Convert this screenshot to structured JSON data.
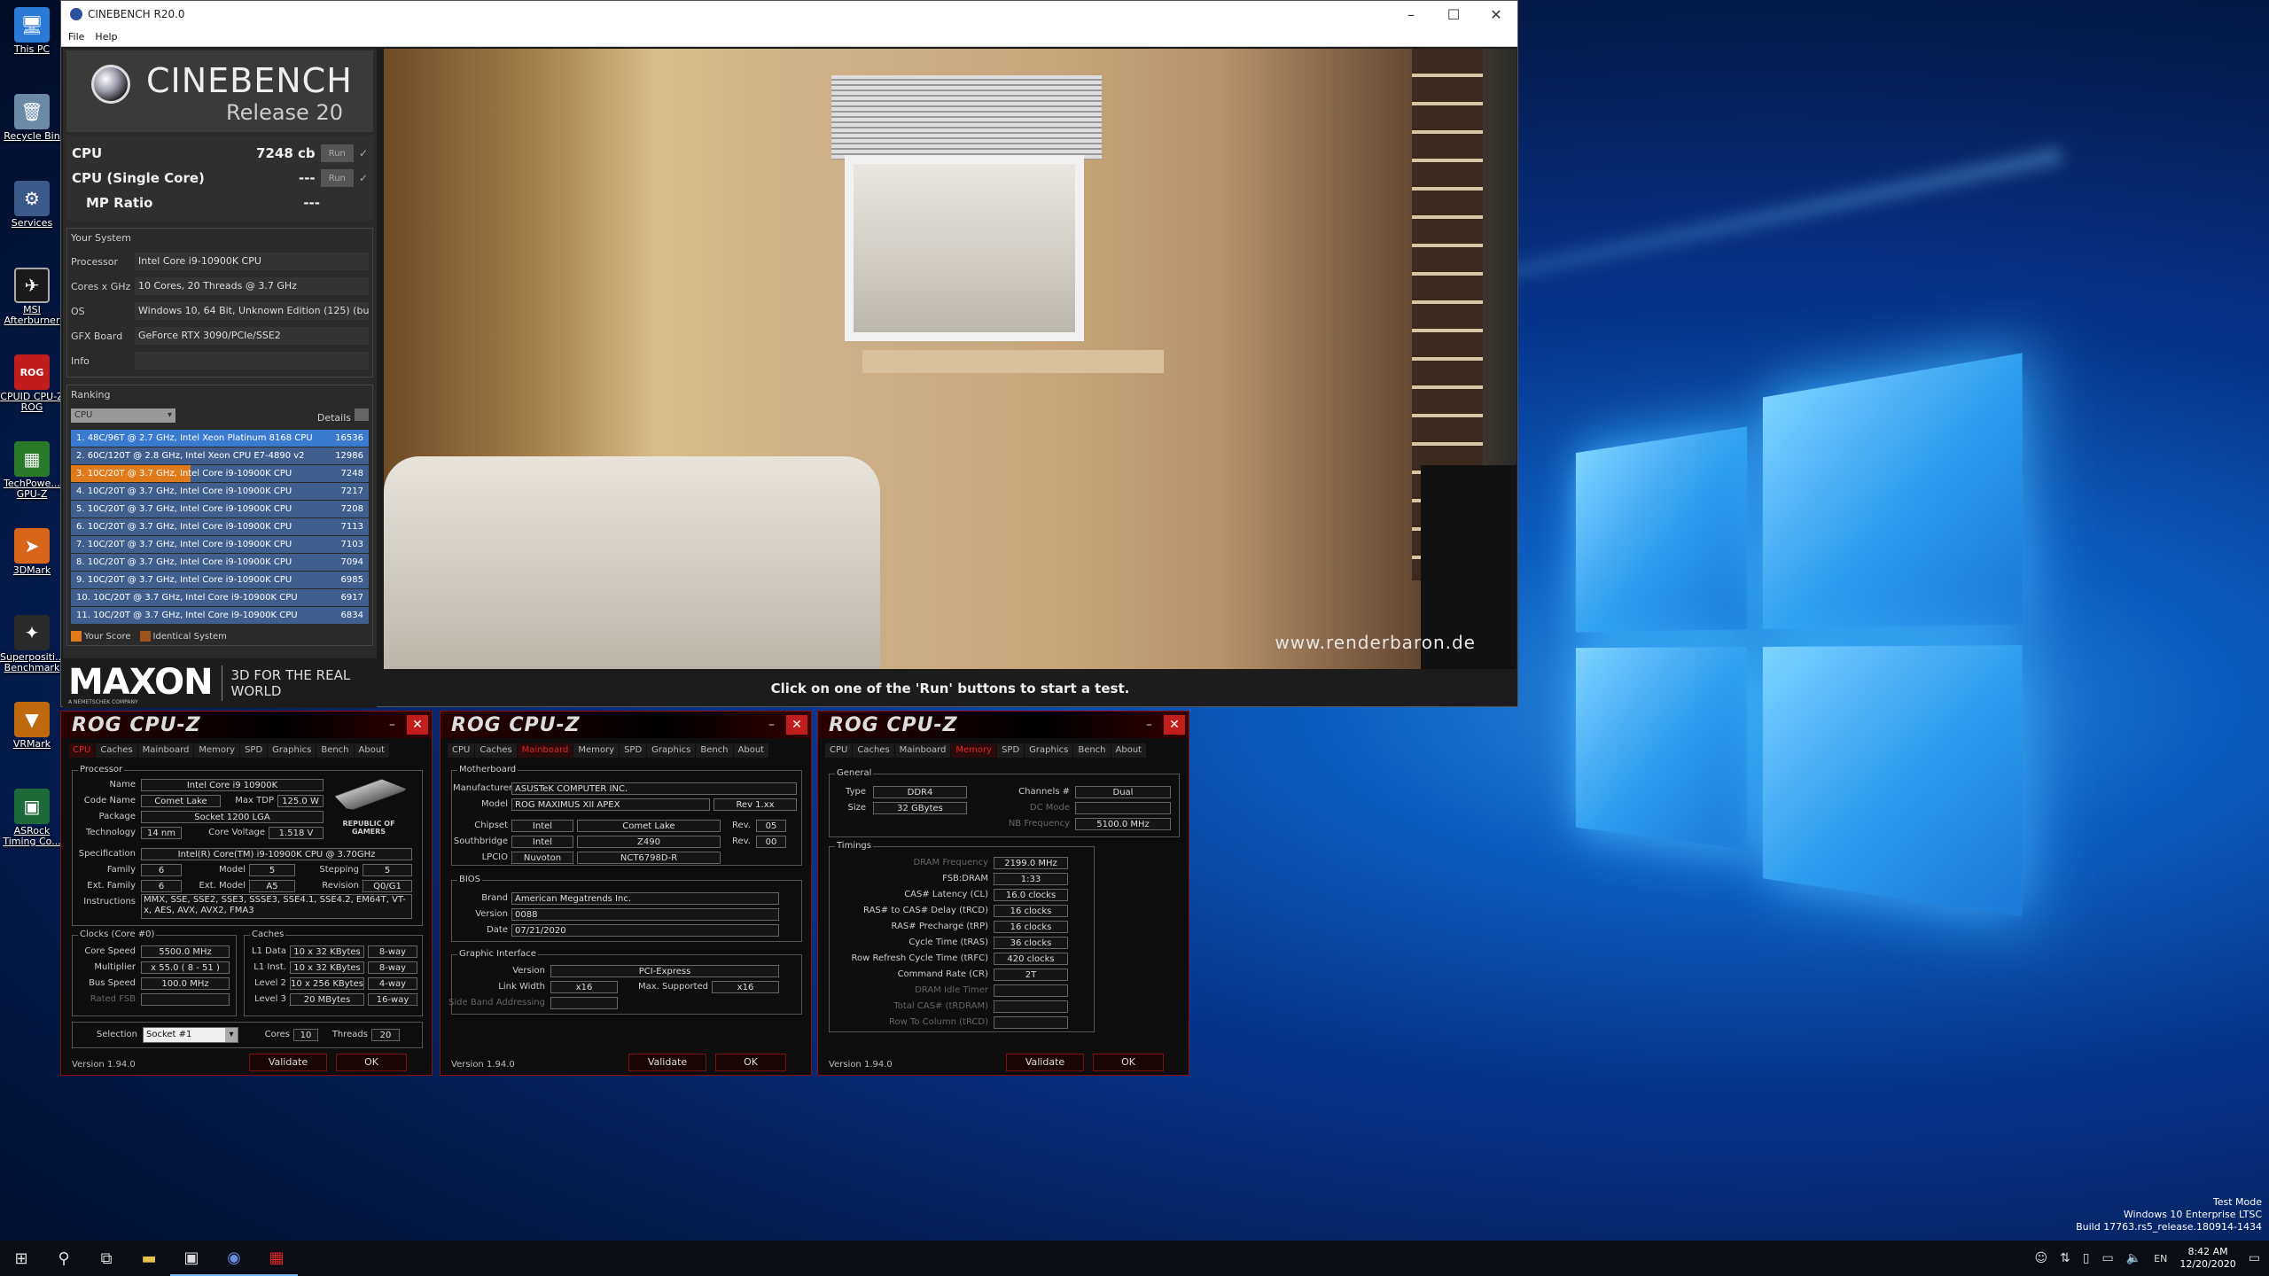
{
  "desktop": {
    "icons": [
      {
        "label": "This PC",
        "icon": "computer-icon"
      },
      {
        "label": "Recycle Bin",
        "icon": "recycle-bin-icon"
      },
      {
        "label": "Services",
        "icon": "gears-icon"
      },
      {
        "label": "MSI Afterburner",
        "icon": "afterburner-icon"
      },
      {
        "label": "CPUID CPU-Z ROG",
        "icon": "cpuz-rog-icon"
      },
      {
        "label": "TechPowe... GPU-Z",
        "icon": "gpuz-icon"
      },
      {
        "label": "3DMark",
        "icon": "3dmark-icon"
      },
      {
        "label": "Superpositi... Benchmark",
        "icon": "superposition-icon"
      },
      {
        "label": "VRMark",
        "icon": "vrmark-icon"
      },
      {
        "label": "ASRock Timing Co...",
        "icon": "asrock-icon"
      }
    ]
  },
  "cinebench": {
    "title": "CINEBENCH R20.0",
    "menu": [
      "File",
      "Help"
    ],
    "logo": {
      "name": "CINEBENCH",
      "release": "Release 20"
    },
    "scores": [
      {
        "name": "CPU",
        "value": "7248 cb",
        "run": "Run",
        "check": "✓"
      },
      {
        "name": "CPU (Single Core)",
        "value": "---",
        "run": "Run",
        "check": "✓"
      },
      {
        "name": "MP Ratio",
        "value": "---"
      }
    ],
    "system": {
      "title": "Your System",
      "rows": [
        {
          "key": "Processor",
          "value": "Intel Core i9-10900K CPU"
        },
        {
          "key": "Cores x GHz",
          "value": "10 Cores, 20 Threads @ 3.7 GHz"
        },
        {
          "key": "OS",
          "value": "Windows 10, 64 Bit, Unknown Edition (125) (buil"
        },
        {
          "key": "GFX Board",
          "value": "GeForce RTX 3090/PCIe/SSE2"
        },
        {
          "key": "Info",
          "value": ""
        }
      ]
    },
    "ranking": {
      "title": "Ranking",
      "select": "CPU",
      "details": "Details",
      "items": [
        {
          "text": "1. 48C/96T @ 2.7 GHz, Intel Xeon Platinum 8168 CPU",
          "score": "16536"
        },
        {
          "text": "2. 60C/120T @ 2.8 GHz, Intel Xeon CPU E7-4890 v2",
          "score": "12986"
        },
        {
          "text": "3. 10C/20T @ 3.7 GHz, Intel Core i9-10900K CPU",
          "score": "7248"
        },
        {
          "text": "4. 10C/20T @ 3.7 GHz, Intel Core i9-10900K CPU",
          "score": "7217"
        },
        {
          "text": "5. 10C/20T @ 3.7 GHz, Intel Core i9-10900K CPU",
          "score": "7208"
        },
        {
          "text": "6. 10C/20T @ 3.7 GHz, Intel Core i9-10900K CPU",
          "score": "7113"
        },
        {
          "text": "7. 10C/20T @ 3.7 GHz, Intel Core i9-10900K CPU",
          "score": "7103"
        },
        {
          "text": "8. 10C/20T @ 3.7 GHz, Intel Core i9-10900K CPU",
          "score": "7094"
        },
        {
          "text": "9. 10C/20T @ 3.7 GHz, Intel Core i9-10900K CPU",
          "score": "6985"
        },
        {
          "text": "10. 10C/20T @ 3.7 GHz, Intel Core i9-10900K CPU",
          "score": "6917"
        },
        {
          "text": "11. 10C/20T @ 3.7 GHz, Intel Core i9-10900K CPU",
          "score": "6834"
        }
      ],
      "legend": [
        {
          "label": "Your Score",
          "color": "#e07a1a"
        },
        {
          "label": "Identical System",
          "color": "#a0521c"
        }
      ]
    },
    "maxon": {
      "brand": "MAXON",
      "sub": "A NEMETSCHEK COMPANY",
      "tagline": "3D FOR THE REAL WORLD"
    },
    "render_watermark": "www.renderbaron.de",
    "status": "Click on one of the 'Run' buttons to start a test."
  },
  "cpuz_common": {
    "title": "ROG CPU-Z",
    "tabs": [
      "CPU",
      "Caches",
      "Mainboard",
      "Memory",
      "SPD",
      "Graphics",
      "Bench",
      "About"
    ],
    "version": "Version 1.94.0",
    "validate": "Validate",
    "ok": "OK",
    "minimize": "–",
    "close": "✕"
  },
  "cpuz1": {
    "processor_legend": "Processor",
    "name": {
      "label": "Name",
      "value": "Intel Core i9 10900K"
    },
    "codename": {
      "label": "Code Name",
      "value": "Comet Lake"
    },
    "maxtdp": {
      "label": "Max TDP",
      "value": "125.0 W"
    },
    "package": {
      "label": "Package",
      "value": "Socket 1200 LGA"
    },
    "technology": {
      "label": "Technology",
      "value": "14 nm"
    },
    "corevoltage": {
      "label": "Core Voltage",
      "value": "1.518 V"
    },
    "spec": {
      "label": "Specification",
      "value": "Intel(R) Core(TM) i9-10900K CPU @ 3.70GHz"
    },
    "family": {
      "label": "Family",
      "value": "6"
    },
    "model": {
      "label": "Model",
      "value": "5"
    },
    "stepping": {
      "label": "Stepping",
      "value": "5"
    },
    "extfamily": {
      "label": "Ext. Family",
      "value": "6"
    },
    "extmodel": {
      "label": "Ext. Model",
      "value": "A5"
    },
    "revision": {
      "label": "Revision",
      "value": "Q0/G1"
    },
    "instructions": {
      "label": "Instructions",
      "value": "MMX, SSE, SSE2, SSE3, SSSE3, SSE4.1, SSE4.2, EM64T, VT-x, AES, AVX, AVX2, FMA3"
    },
    "rog_logo": "REPUBLIC OF GAMERS",
    "clocks_legend": "Clocks (Core #0)",
    "corespeed": {
      "label": "Core Speed",
      "value": "5500.0 MHz"
    },
    "multiplier": {
      "label": "Multiplier",
      "value": "x 55.0 ( 8 - 51 )"
    },
    "busspeed": {
      "label": "Bus Speed",
      "value": "100.0 MHz"
    },
    "ratedfsb": {
      "label": "Rated FSB",
      "value": ""
    },
    "caches_legend": "Caches",
    "l1data": {
      "label": "L1 Data",
      "value": "10 x 32 KBytes",
      "way": "8-way"
    },
    "l1inst": {
      "label": "L1 Inst.",
      "value": "10 x 32 KBytes",
      "way": "8-way"
    },
    "level2": {
      "label": "Level 2",
      "value": "10 x 256 KBytes",
      "way": "4-way"
    },
    "level3": {
      "label": "Level 3",
      "value": "20 MBytes",
      "way": "16-way"
    },
    "selection": {
      "label": "Selection",
      "value": "Socket #1"
    },
    "cores": {
      "label": "Cores",
      "value": "10"
    },
    "threads": {
      "label": "Threads",
      "value": "20"
    }
  },
  "cpuz2": {
    "mb_legend": "Motherboard",
    "manufacturer": {
      "label": "Manufacturer",
      "value": "ASUSTeK COMPUTER INC."
    },
    "model": {
      "label": "Model",
      "value": "ROG MAXIMUS XII APEX",
      "rev": "Rev 1.xx"
    },
    "chipset": {
      "label": "Chipset",
      "vendor": "Intel",
      "name": "Comet Lake",
      "revlabel": "Rev.",
      "rev": "05"
    },
    "southbridge": {
      "label": "Southbridge",
      "vendor": "Intel",
      "name": "Z490",
      "revlabel": "Rev.",
      "rev": "00"
    },
    "lpcio": {
      "label": "LPCIO",
      "vendor": "Nuvoton",
      "name": "NCT6798D-R"
    },
    "bios_legend": "BIOS",
    "brand": {
      "label": "Brand",
      "value": "American Megatrends Inc."
    },
    "version": {
      "label": "Version",
      "value": "0088"
    },
    "date": {
      "label": "Date",
      "value": "07/21/2020"
    },
    "gi_legend": "Graphic Interface",
    "giversion": {
      "label": "Version",
      "value": "PCI-Express"
    },
    "linkwidth": {
      "label": "Link Width",
      "value": "x16",
      "maxlabel": "Max. Supported",
      "max": "x16"
    },
    "sideband": {
      "label": "Side Band Addressing",
      "value": ""
    }
  },
  "cpuz3": {
    "general_legend": "General",
    "type": {
      "label": "Type",
      "value": "DDR4"
    },
    "size": {
      "label": "Size",
      "value": "32 GBytes"
    },
    "channels": {
      "label": "Channels #",
      "value": "Dual"
    },
    "dcmode": {
      "label": "DC Mode",
      "value": ""
    },
    "nbfreq": {
      "label": "NB Frequency",
      "value": "5100.0 MHz"
    },
    "timings_legend": "Timings",
    "timings": [
      {
        "label": "DRAM Frequency",
        "value": "2199.0 MHz",
        "dim": true
      },
      {
        "label": "FSB:DRAM",
        "value": "1:33",
        "dim": false
      },
      {
        "label": "CAS# Latency (CL)",
        "value": "16.0 clocks",
        "dim": false
      },
      {
        "label": "RAS# to CAS# Delay (tRCD)",
        "value": "16 clocks",
        "dim": false
      },
      {
        "label": "RAS# Precharge (tRP)",
        "value": "16 clocks",
        "dim": false
      },
      {
        "label": "Cycle Time (tRAS)",
        "value": "36 clocks",
        "dim": false
      },
      {
        "label": "Row Refresh Cycle Time (tRFC)",
        "value": "420 clocks",
        "dim": false
      },
      {
        "label": "Command Rate (CR)",
        "value": "2T",
        "dim": false
      },
      {
        "label": "DRAM Idle Timer",
        "value": "",
        "dim": true
      },
      {
        "label": "Total CAS# (tRDRAM)",
        "value": "",
        "dim": true
      },
      {
        "label": "Row To Column (tRCD)",
        "value": "",
        "dim": true
      }
    ]
  },
  "system_watermark": [
    "Test Mode",
    "Windows 10 Enterprise LTSC",
    "Build 17763.rs5_release.180914-1434"
  ],
  "taskbar": {
    "time": "8:42 AM",
    "date": "12/20/2020",
    "tray_lang": "EN"
  }
}
